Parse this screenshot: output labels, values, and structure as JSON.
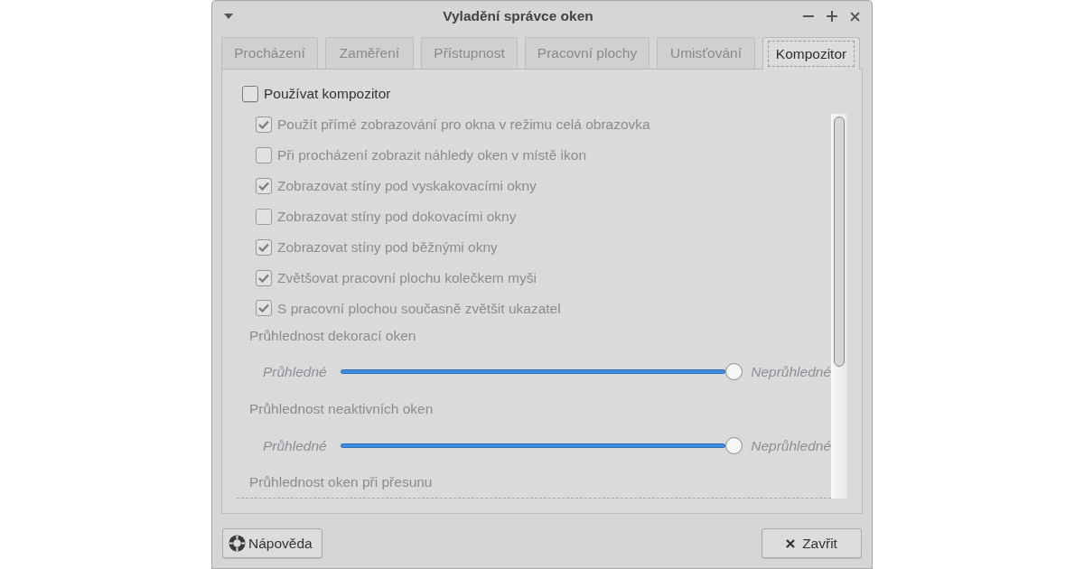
{
  "window": {
    "title": "Vyladění správce oken"
  },
  "tabs": [
    {
      "label": "Procházení",
      "selected": false
    },
    {
      "label": "Zaměření",
      "selected": false
    },
    {
      "label": "Přístupnost",
      "selected": false
    },
    {
      "label": "Pracovní plochy",
      "selected": false
    },
    {
      "label": "Umisťování",
      "selected": false
    },
    {
      "label": "Kompozitor",
      "selected": true
    }
  ],
  "compositor": {
    "label": "Používat kompozitor",
    "checked": false
  },
  "options": [
    {
      "label": "Použít přímé zobrazování pro okna v režimu celá obrazovka",
      "checked": true,
      "disabled": true
    },
    {
      "label": "Při procházení zobrazit náhledy oken v místě ikon",
      "checked": false,
      "disabled": true
    },
    {
      "label": "Zobrazovat stíny pod vyskakovacími okny",
      "checked": true,
      "disabled": true
    },
    {
      "label": "Zobrazovat stíny pod dokovacími okny",
      "checked": false,
      "disabled": true
    },
    {
      "label": "Zobrazovat stíny pod běžnými okny",
      "checked": true,
      "disabled": true
    },
    {
      "label": "Zvětšovat pracovní plochu kolečkem myši",
      "checked": true,
      "disabled": true
    },
    {
      "label": "S pracovní plochou současně zvětšit ukazatel",
      "checked": true,
      "disabled": true
    }
  ],
  "sliders": [
    {
      "label": "Průhlednost dekorací oken",
      "min_label": "Průhledné",
      "max_label": "Neprůhledné",
      "level": 1,
      "disabled": true
    },
    {
      "label": "Průhlednost neaktivních oken",
      "min_label": "Průhledné",
      "max_label": "Neprůhledné",
      "level": 1,
      "disabled": true
    },
    {
      "label": "Průhlednost oken při přesunu",
      "disabled": true
    }
  ],
  "buttons": [
    {
      "kind": "help",
      "label": "Nápověda"
    },
    {
      "kind": "close",
      "label": "Zavřit"
    }
  ]
}
